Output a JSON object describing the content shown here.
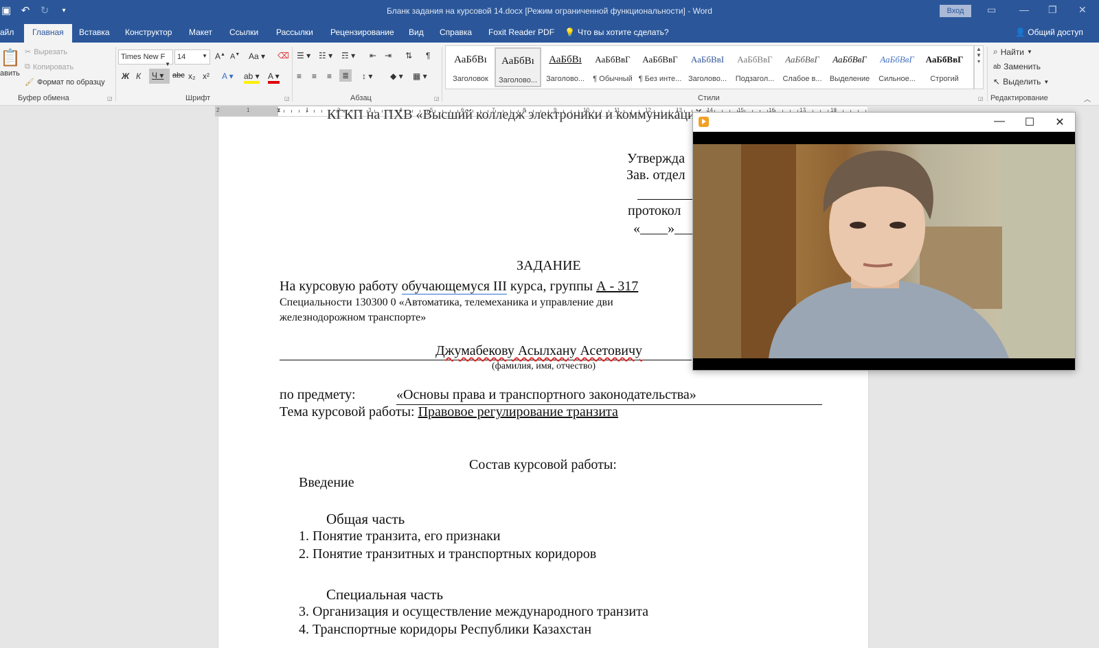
{
  "titlebar": {
    "title": "Бланк задания на курсовой 14.docx [Режим ограниченной функциональности]  -  Word",
    "login": "Вход"
  },
  "tabs": {
    "file": "айл",
    "home": "Главная",
    "insert": "Вставка",
    "design": "Конструктор",
    "layout": "Макет",
    "references": "Ссылки",
    "mailings": "Рассылки",
    "review": "Рецензирование",
    "view": "Вид",
    "help": "Справка",
    "foxit": "Foxit Reader PDF",
    "tell_me": "Что вы хотите сделать?",
    "share": "Общий доступ"
  },
  "ribbon": {
    "clipboard": {
      "paste": "авить",
      "cut": "Вырезать",
      "copy": "Копировать",
      "format_painter": "Формат по образцу",
      "label": "Буфер обмена"
    },
    "font": {
      "name": "Times New F",
      "size": "14",
      "label": "Шрифт",
      "bold": "Ж",
      "italic": "К",
      "underline": "Ч",
      "strike": "abc",
      "sub": "x₂",
      "sup": "x²",
      "change_case": "Aa",
      "grow": "A",
      "shrink": "A"
    },
    "paragraph": {
      "label": "Абзац"
    },
    "styles": {
      "label": "Стили",
      "items": [
        {
          "preview": "АаБбВı",
          "name": "Заголовок"
        },
        {
          "preview": "АаБбВı",
          "name": "Заголово..."
        },
        {
          "preview": "АаБбВı",
          "name": "Заголово..."
        },
        {
          "preview": "АаБбВвГ",
          "name": "¶ Обычный"
        },
        {
          "preview": "АаБбВвГ",
          "name": "¶ Без инте..."
        },
        {
          "preview": "АаБбВвI",
          "name": "Заголово..."
        },
        {
          "preview": "АаБбВвГ",
          "name": "Подзагол..."
        },
        {
          "preview": "АаБбВвГ",
          "name": "Слабое в..."
        },
        {
          "preview": "АаБбВвГ",
          "name": "Выделение"
        },
        {
          "preview": "АаБбВвГ",
          "name": "Сильное..."
        },
        {
          "preview": "АаБбВвГ",
          "name": "Строгий"
        }
      ]
    },
    "editing": {
      "label": "Редактирование",
      "find": "Найти",
      "replace": "Заменить",
      "select": "Выделить"
    }
  },
  "ruler": {
    "numbers": [
      "2",
      "1",
      "1",
      "2",
      "3",
      "4",
      "5",
      "6",
      "7",
      "8",
      "9",
      "10",
      "11",
      "12",
      "13",
      "14",
      "15",
      "16",
      "17",
      "18"
    ]
  },
  "document": {
    "top_cut": "КГКП на ПХВ «Высший колледж электроники и коммуникаций»",
    "approve_1": "Утвержда",
    "approve_2": "Зав. отдел",
    "approve_3": "протокол",
    "approve_4": "«____»___",
    "heading": "ЗАДАНИЕ",
    "line1_a": "На курсовую работу",
    "line1_b": "обучающемуся  III",
    "line1_c": "курса, группы",
    "line1_d": "А - 317",
    "specialty_1": "Специальности  130300 0 «Автоматика, телемеханика и  управление  дви",
    "specialty_2": "железнодорожном транспорте»",
    "student": "Джумабекову Асылхану Асетовичу",
    "student_caption": "(фамилия, имя, отчество)",
    "subject_label": "по предмету:",
    "subject_value": "«Основы права и транспортного законодательства»",
    "topic_label": "Тема курсовой работы:",
    "topic_value": "Правовое регулирование транзита",
    "composition": "Состав курсовой работы:",
    "intro": "Введение",
    "general": "Общая часть",
    "item1": "1. Понятие транзита, его признаки",
    "item2": "2. Понятие транзитных и транспортных коридоров",
    "special": "Специальная часть",
    "item3": "3. Организация и осуществление международного транзита",
    "item4": "4. Транспортные коридоры Республики Казахстан"
  },
  "video_window": {
    "minimize": "—",
    "maximize": "☐",
    "close": "✕"
  }
}
